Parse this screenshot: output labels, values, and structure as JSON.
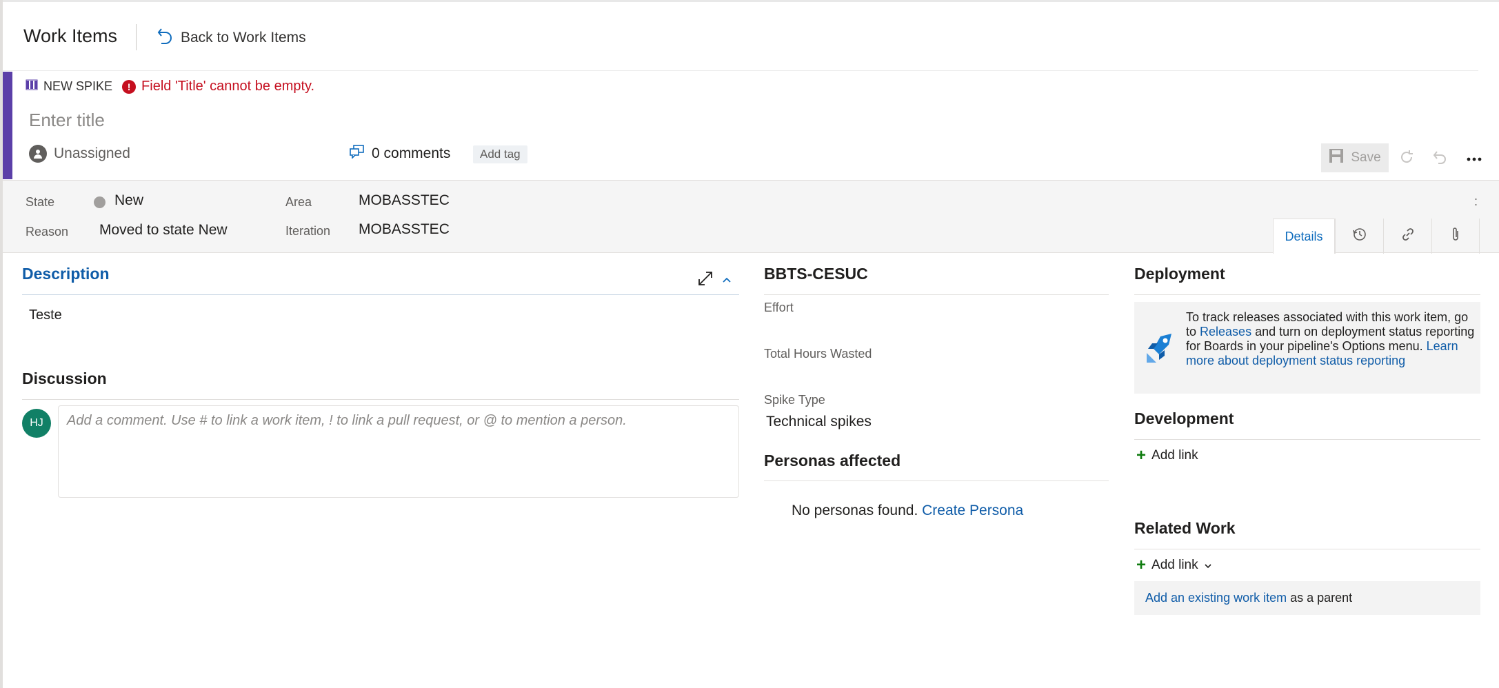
{
  "header": {
    "title": "Work Items",
    "back_label": "Back to Work Items"
  },
  "work_item": {
    "type_label": "NEW SPIKE",
    "error_message": "Field 'Title' cannot be empty.",
    "title_placeholder": "Enter title",
    "title_value": "",
    "assignee": "Unassigned",
    "comments_label": "0 comments",
    "add_tag_label": "Add tag",
    "save_label": "Save",
    "accent_color": "#5b3fa8"
  },
  "fields": {
    "state_label": "State",
    "state_value": "New",
    "reason_label": "Reason",
    "reason_value": "Moved to state New",
    "area_label": "Area",
    "area_value": "MOBASSTEC",
    "iteration_label": "Iteration",
    "iteration_value": "MOBASSTEC",
    "more_label": ":"
  },
  "tabs": {
    "details_label": "Details",
    "icons": [
      "history-icon",
      "link-icon",
      "attachment-icon"
    ]
  },
  "description": {
    "heading": "Description",
    "text": "Teste"
  },
  "discussion": {
    "heading": "Discussion",
    "avatar_initials": "HJ",
    "comment_placeholder": "Add a comment. Use # to link a work item, ! to link a pull request, or @ to mention a person."
  },
  "custom_group": {
    "heading": "BBTS-CESUC",
    "effort_label": "Effort",
    "effort_value": "",
    "hours_label": "Total Hours Wasted",
    "hours_value": "",
    "spike_type_label": "Spike Type",
    "spike_type_value": "Technical spikes"
  },
  "personas": {
    "heading": "Personas affected",
    "empty_text": "No personas found.",
    "create_link": "Create Persona"
  },
  "deployment": {
    "heading": "Deployment",
    "text_before": "To track releases associated with this work item, go to",
    "releases_link": "Releases",
    "text_after": "and turn on deployment status reporting for Boards in your pipeline's Options menu.",
    "learn_more_link": "Learn more about deployment status reporting"
  },
  "development": {
    "heading": "Development",
    "add_link_label": "Add link"
  },
  "related_work": {
    "heading": "Related Work",
    "add_link_label": "Add link",
    "existing_link": "Add an existing work item",
    "existing_suffix": "as a parent"
  }
}
